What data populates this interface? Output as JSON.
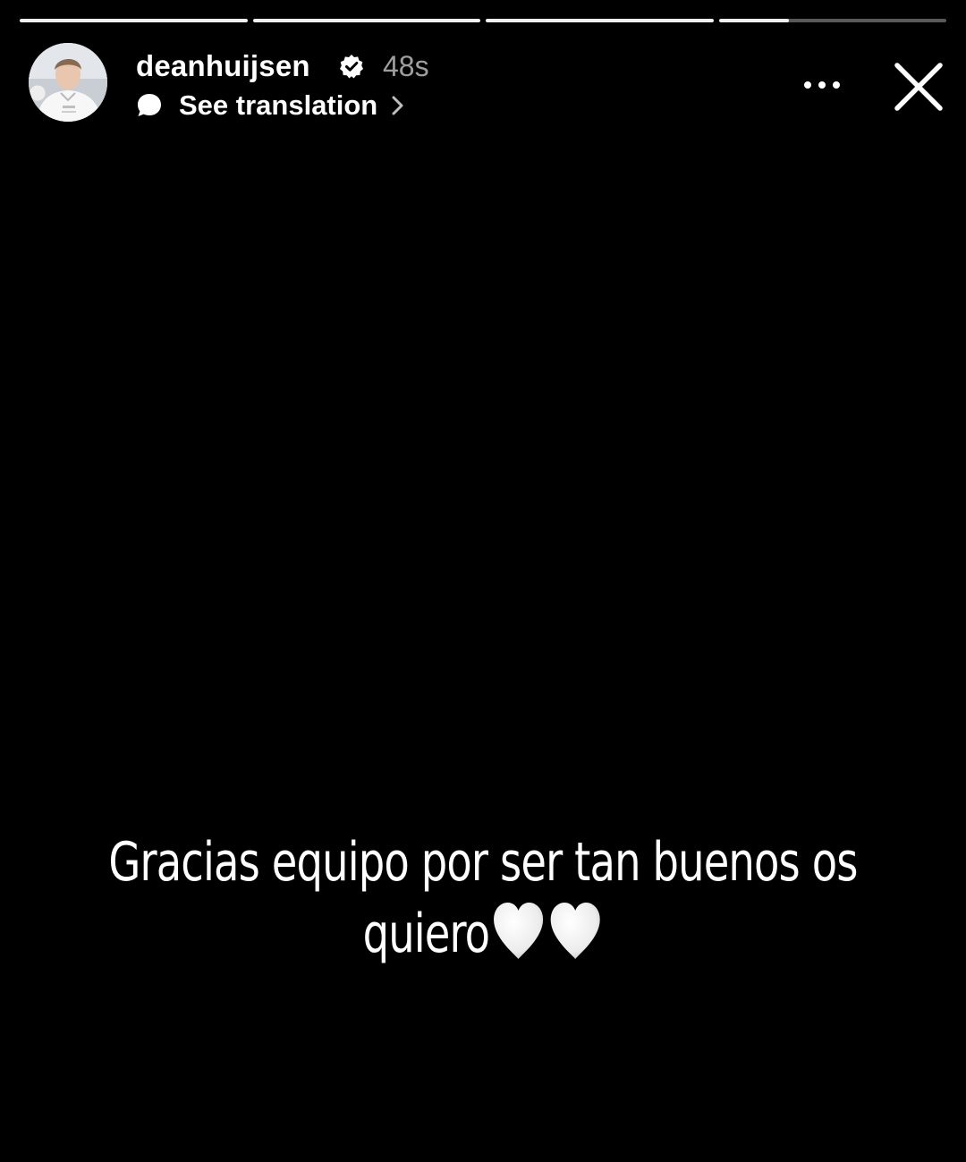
{
  "story": {
    "progress": [
      1,
      1,
      1,
      0.31
    ],
    "author": {
      "username": "deanhuijsen",
      "verified": true,
      "time_ago": "48s"
    },
    "translation": {
      "label": "See translation"
    },
    "caption": {
      "line1": "Gracias equipo por ser tan buenos os",
      "line2": "quiero",
      "emoji": [
        "white-heart",
        "white-heart"
      ]
    }
  },
  "icons": {
    "verified": "verified-badge-icon",
    "translation": "speech-bubble-icon",
    "chevron": "chevron-right-icon",
    "more": "more-options-icon",
    "close": "close-icon"
  },
  "colors": {
    "background": "#000000",
    "text": "#ffffff",
    "muted": "#9e9e9e",
    "heart": "#f2f2f2"
  }
}
